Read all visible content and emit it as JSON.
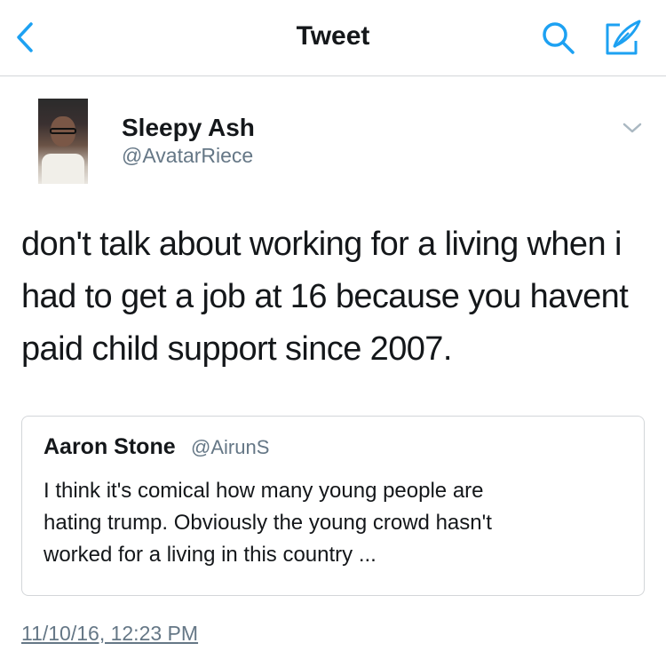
{
  "header": {
    "title": "Tweet",
    "back_icon": "chevron-left-icon",
    "search_icon": "search-icon",
    "compose_icon": "compose-icon",
    "accent_color": "#1da1f2"
  },
  "tweet": {
    "author": {
      "display_name": "Sleepy Ash",
      "handle": "@AvatarRiece"
    },
    "text": "don't talk about working for a living when i\nhad to get a job at 16 because you havent\npaid child support since 2007.",
    "timestamp": "11/10/16, 12:23 PM",
    "quoted": {
      "display_name": "Aaron Stone",
      "handle": "@AirunS",
      "text": "I think it's comical how many young people are\nhating trump. Obviously the young crowd hasn't\nworked for a living in this country ..."
    }
  }
}
